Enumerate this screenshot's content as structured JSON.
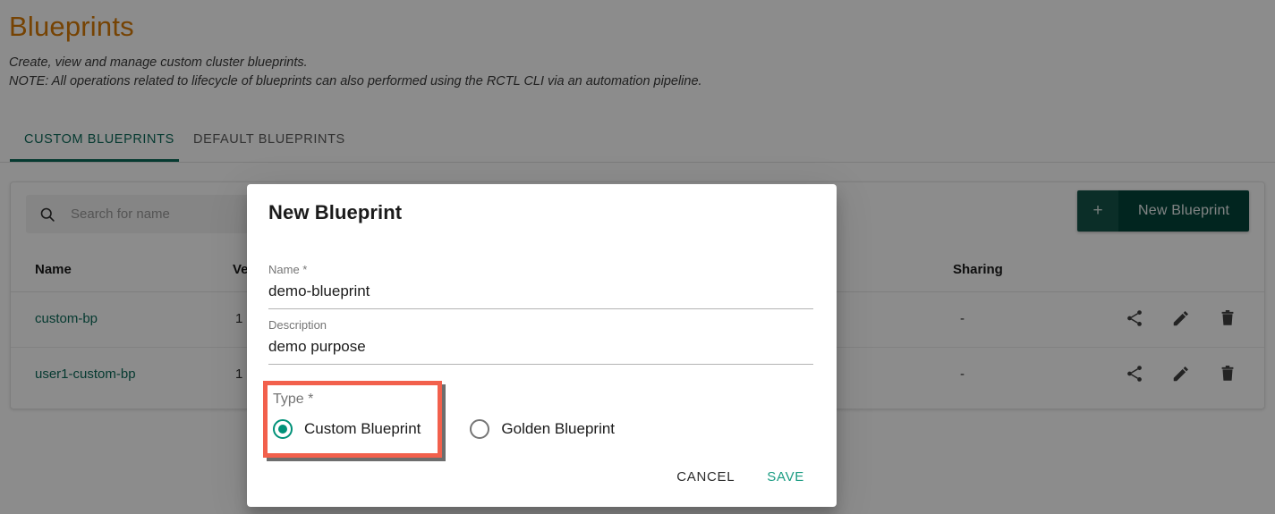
{
  "page": {
    "title": "Blueprints",
    "subtitle_line1": "Create, view and manage custom cluster blueprints.",
    "subtitle_line2": "NOTE: All operations related to lifecycle of blueprints can also performed using the RCTL CLI via an automation pipeline.",
    "title_color": "#d87a06",
    "accent_color": "#0c6b5a"
  },
  "tabs": [
    {
      "label": "CUSTOM BLUEPRINTS",
      "active": true
    },
    {
      "label": "DEFAULT BLUEPRINTS",
      "active": false
    }
  ],
  "toolbar": {
    "search_placeholder": "Search for name",
    "search_value": "",
    "search_icon": "search-icon",
    "new_blueprint_label": "New Blueprint",
    "new_blueprint_plus": "+",
    "new_blueprint_bg": "#03443a"
  },
  "table": {
    "columns": [
      "Name",
      "Version",
      "Sharing"
    ],
    "rows": [
      {
        "name": "custom-bp",
        "version": "1",
        "sharing": "-",
        "actions": [
          "share-icon",
          "edit-icon",
          "delete-icon"
        ]
      },
      {
        "name": "user1-custom-bp",
        "version": "1",
        "sharing": "-",
        "actions": [
          "share-icon",
          "edit-icon",
          "delete-icon"
        ]
      }
    ]
  },
  "modal": {
    "title": "New Blueprint",
    "fields": {
      "name": {
        "label": "Name *",
        "value": "demo-blueprint"
      },
      "description": {
        "label": "Description",
        "value": "demo purpose"
      },
      "type": {
        "label": "Type *",
        "options": [
          {
            "label": "Custom Blueprint",
            "selected": true
          },
          {
            "label": "Golden Blueprint",
            "selected": false
          }
        ],
        "highlight_color": "#f2604c",
        "selected_color": "#009178"
      }
    },
    "cancel_label": "CANCEL",
    "save_label": "SAVE"
  }
}
